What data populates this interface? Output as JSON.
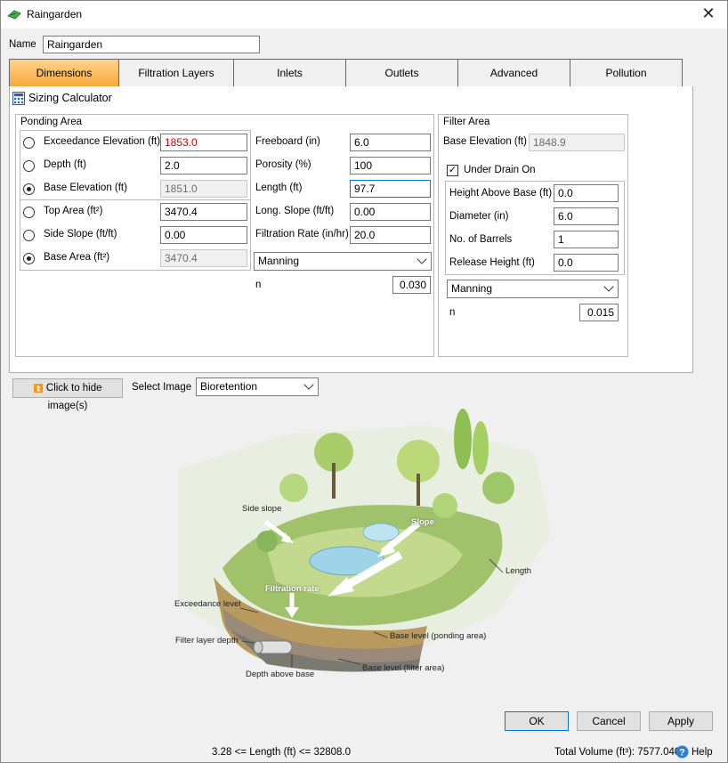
{
  "window": {
    "title": "Raingarden"
  },
  "name_field": {
    "label": "Name",
    "value": "Raingarden"
  },
  "tabs": [
    {
      "label": "Dimensions",
      "active": true
    },
    {
      "label": "Filtration Layers"
    },
    {
      "label": "Inlets"
    },
    {
      "label": "Outlets"
    },
    {
      "label": "Advanced"
    },
    {
      "label": "Pollution"
    }
  ],
  "sizing_calculator": {
    "label": "Sizing Calculator"
  },
  "ponding": {
    "title": "Ponding Area",
    "rows": [
      {
        "label": "Exceedance Elevation (ft)",
        "value": "1853.0",
        "selected": false
      },
      {
        "label": "Depth (ft)",
        "value": "2.0",
        "selected": false
      },
      {
        "label": "Base Elevation (ft)",
        "value": "1851.0",
        "selected": true
      },
      {
        "label": "Top Area (ft²)",
        "value": "3470.4",
        "selected": false
      },
      {
        "label": "Side Slope (ft/ft)",
        "value": "0.00",
        "selected": false
      },
      {
        "label": "Base Area (ft²)",
        "value": "3470.4",
        "selected": true
      }
    ],
    "right": [
      {
        "label": "Freeboard (in)",
        "value": "6.0"
      },
      {
        "label": "Porosity (%)",
        "value": "100"
      },
      {
        "label": "Length (ft)",
        "value": "97.7"
      },
      {
        "label": "Long. Slope (ft/ft)",
        "value": "0.00"
      },
      {
        "label": "Filtration Rate (in/hr)",
        "value": "20.0"
      }
    ],
    "roughness_method": "Manning",
    "n_label": "n",
    "n_value": "0.030"
  },
  "filter": {
    "title": "Filter Area",
    "base_elevation_label": "Base Elevation (ft)",
    "base_elevation_value": "1848.9",
    "under_drain_label": "Under Drain On",
    "under_drain_checked": true,
    "rows": [
      {
        "label": "Height Above Base (ft)",
        "value": "0.0"
      },
      {
        "label": "Diameter (in)",
        "value": "6.0"
      },
      {
        "label": "No. of Barrels",
        "value": "1"
      },
      {
        "label": "Release Height (ft)",
        "value": "0.0"
      }
    ],
    "roughness_method": "Manning",
    "n_label": "n",
    "n_value": "0.015"
  },
  "image_controls": {
    "hide_button": "Click to hide image(s)",
    "select_label": "Select Image",
    "selected_image": "Bioretention"
  },
  "diagram_labels": {
    "side_slope": "Side slope",
    "slope": "Slope",
    "length": "Length",
    "filtration_rate": "Filtration rate",
    "exceedance_level": "Exceedance level",
    "filter_layer_depth": "Filter layer depth",
    "depth_above_base": "Depth above base",
    "base_level_ponding": "Base level (ponding area)",
    "base_level_filter": "Base level (filter area)"
  },
  "buttons": {
    "ok": "OK",
    "cancel": "Cancel",
    "apply": "Apply"
  },
  "status": {
    "length_range": "3.28 <= Length (ft) <= 32808.0",
    "total_volume": "Total Volume (ft³): 7577.040",
    "help": "Help"
  },
  "colors": {
    "active_tab": "#f7a93a",
    "error_text": "#d00000",
    "focus_border": "#0078d7"
  }
}
